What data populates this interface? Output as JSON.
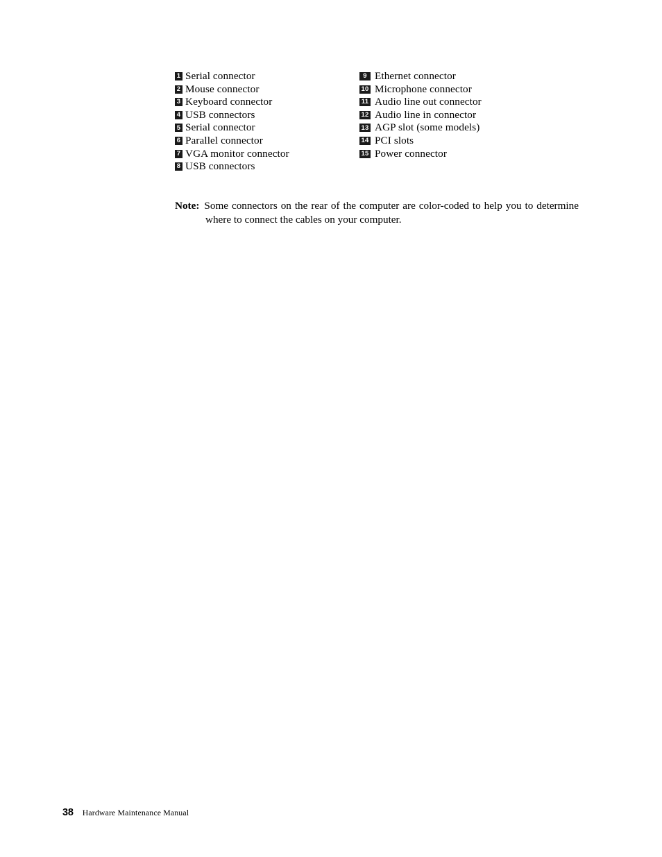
{
  "document": {
    "type": "hardware-maintenance-manual-page"
  },
  "legend": {
    "columns": [
      {
        "name": "left-column",
        "items": [
          {
            "number": "1",
            "label": "Serial connector"
          },
          {
            "number": "2",
            "label": "Mouse connector"
          },
          {
            "number": "3",
            "label": "Keyboard connector"
          },
          {
            "number": "4",
            "label": "USB connectors"
          },
          {
            "number": "5",
            "label": "Serial connector"
          },
          {
            "number": "6",
            "label": "Parallel connector"
          },
          {
            "number": "7",
            "label": "VGA monitor connector"
          },
          {
            "number": "8",
            "label": "USB connectors"
          }
        ]
      },
      {
        "name": "right-column",
        "items": [
          {
            "number": "9",
            "label": "Ethernet connector"
          },
          {
            "number": "10",
            "label": "Microphone connector"
          },
          {
            "number": "11",
            "label": "Audio line out connector"
          },
          {
            "number": "12",
            "label": "Audio line in connector"
          },
          {
            "number": "13",
            "label": "AGP slot (some models)"
          },
          {
            "number": "14",
            "label": "PCI slots"
          },
          {
            "number": "15",
            "label": "Power connector"
          }
        ]
      }
    ]
  },
  "note": {
    "label": "Note:",
    "text": "Some connectors on the rear of the computer are color-coded to help you to determine where to connect the cables on your computer."
  },
  "footer": {
    "page_number": "38",
    "title": "Hardware Maintenance Manual"
  },
  "colors": {
    "page_background": "#ffffff",
    "text": "#000000",
    "badge_background": "#1a1a1a",
    "badge_text": "#ffffff"
  }
}
